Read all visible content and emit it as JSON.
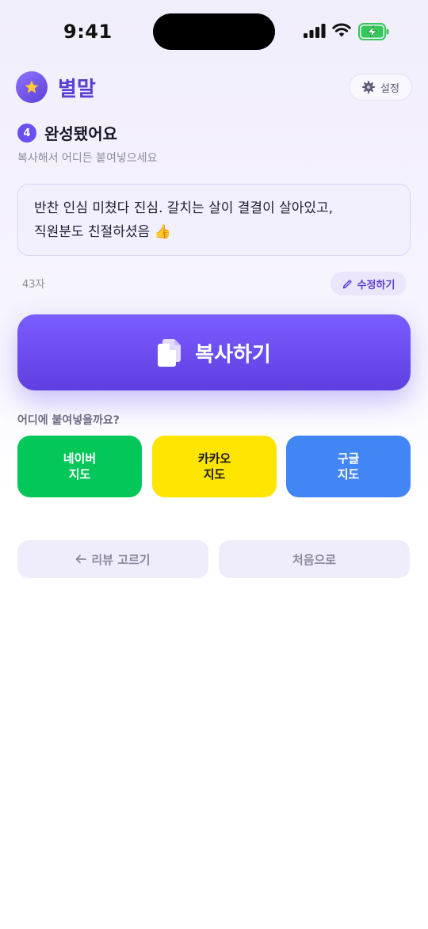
{
  "status_bar": {
    "time": "9:41"
  },
  "header": {
    "brand": "별말",
    "settings_label": "설정"
  },
  "step": {
    "number": "4",
    "title": "완성됐어요",
    "subtitle": "복사해서 어디든 붙여넣으세요"
  },
  "review": {
    "line1": "반찬 인심 미쳤다 진심. 갈치는 살이 결결이 살아있고,",
    "line2": "직원분도 친절하셨음 👍",
    "char_count": "43자",
    "edit_label": "수정하기"
  },
  "copy_button": {
    "label": "복사하기"
  },
  "paste_targets": {
    "label": "어디에 붙여넣을까요?",
    "naver": {
      "line1": "네이버",
      "line2": "지도",
      "color": "#04c75a"
    },
    "kakao": {
      "line1": "카카오",
      "line2": "지도",
      "color": "#fee500"
    },
    "google": {
      "line1": "구글",
      "line2": "지도",
      "color": "#4285f4"
    }
  },
  "footer": {
    "back_label": "리뷰 고르기",
    "home_label": "처음으로"
  },
  "icons": {
    "logo": "star-icon",
    "settings": "gear-icon",
    "edit": "pencil-icon",
    "copy": "copy-icon",
    "back": "arrow-left-icon"
  },
  "colors": {
    "accent": "#6b4ff0",
    "brand_text": "#5b3fd4"
  }
}
